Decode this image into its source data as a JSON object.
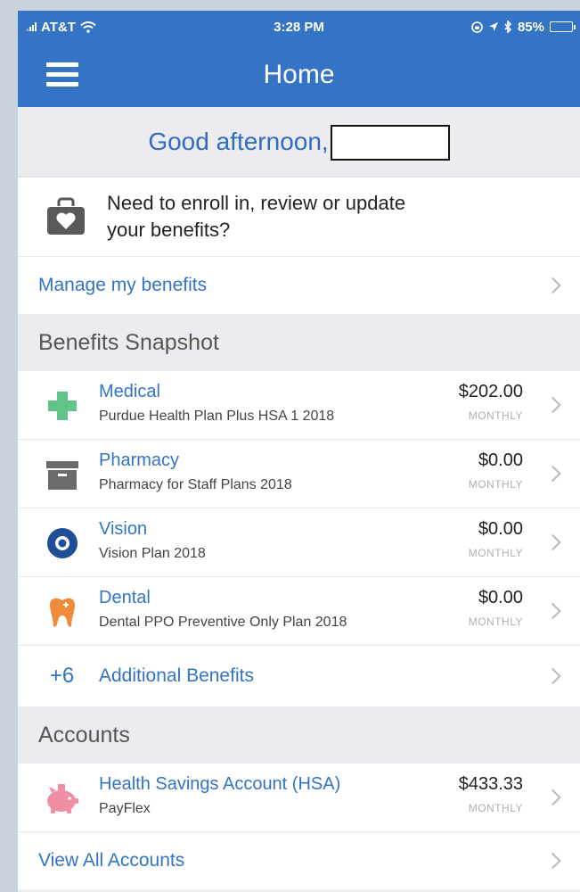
{
  "status_bar": {
    "carrier": "AT&T",
    "time": "3:28 PM",
    "battery": "85%",
    "battery_level": 0.85
  },
  "nav": {
    "title": "Home",
    "menu_icon": "hamburger-menu-icon"
  },
  "greeting": {
    "text": "Good afternoon,"
  },
  "promo": {
    "icon": "briefcase-heart-icon",
    "line1": "Need to enroll in, review or update",
    "line2": "your benefits?"
  },
  "manage_link": {
    "label": "Manage my benefits"
  },
  "benefits_section": {
    "heading": "Benefits Snapshot",
    "items": [
      {
        "title": "Medical",
        "subtitle": "Purdue Health Plan Plus HSA 1 2018",
        "amount": "$202.00",
        "period": "MONTHLY",
        "icon": "medical-cross-icon",
        "color": "#62c38a"
      },
      {
        "title": "Pharmacy",
        "subtitle": "Pharmacy for Staff Plans 2018",
        "amount": "$0.00",
        "period": "MONTHLY",
        "icon": "pharmacy-box-icon",
        "color": "#6b6b6b"
      },
      {
        "title": "Vision",
        "subtitle": "Vision Plan 2018",
        "amount": "$0.00",
        "period": "MONTHLY",
        "icon": "eye-icon",
        "color": "#1f4f99"
      },
      {
        "title": "Dental",
        "subtitle": "Dental PPO Preventive Only Plan 2018",
        "amount": "$0.00",
        "period": "MONTHLY",
        "icon": "tooth-icon",
        "color": "#f08b3c"
      }
    ],
    "additional": {
      "count": "+6",
      "label": "Additional Benefits"
    }
  },
  "accounts_section": {
    "heading": "Accounts",
    "items": [
      {
        "title": "Health Savings Account (HSA)",
        "subtitle": "PayFlex",
        "amount": "$433.33",
        "period": "MONTHLY",
        "icon": "piggy-bank-icon",
        "color": "#ef8fa4"
      }
    ],
    "view_all": {
      "label": "View All Accounts"
    }
  },
  "colors": {
    "brand_blue": "#3573c4",
    "link_blue": "#3373c4",
    "section_bg": "#ececf0"
  }
}
